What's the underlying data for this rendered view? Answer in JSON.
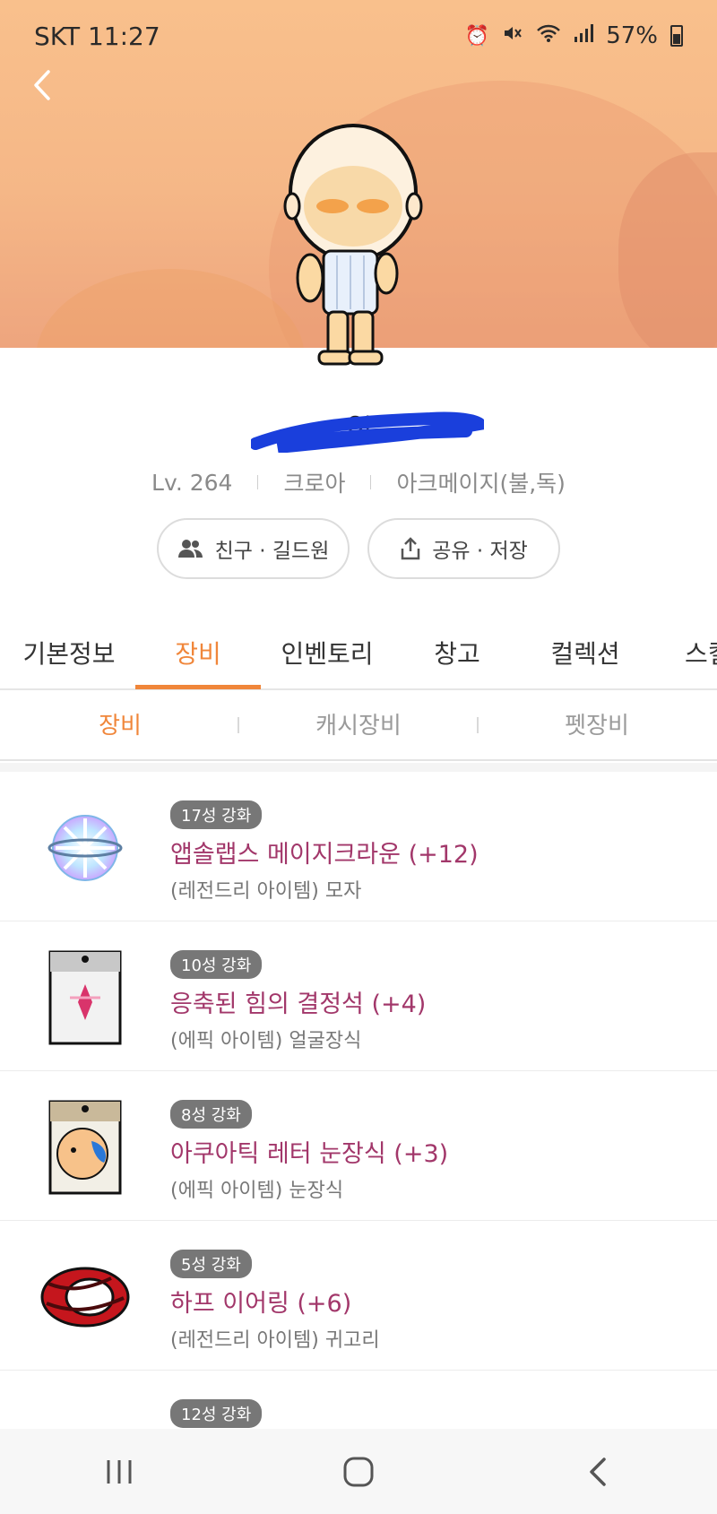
{
  "status_bar": {
    "carrier_time": "SKT 11:27",
    "battery": "57%",
    "icons": [
      "alarm-icon",
      "mute-icon",
      "wifi-icon",
      "signal-icon",
      "battery-icon"
    ]
  },
  "profile": {
    "name": "Ol",
    "level": "Lv. 264",
    "world": "크로아",
    "job": "아크메이지(불,독)",
    "buttons": {
      "friends": "친구 · 길드원",
      "share": "공유 · 저장"
    }
  },
  "tabs": [
    {
      "label": "기본정보"
    },
    {
      "label": "장비"
    },
    {
      "label": "인벤토리"
    },
    {
      "label": "창고"
    },
    {
      "label": "컬렉션"
    },
    {
      "label": "스킬"
    }
  ],
  "active_tab": "장비",
  "subtabs": [
    {
      "label": "장비"
    },
    {
      "label": "캐시장비"
    },
    {
      "label": "펫장비"
    }
  ],
  "items": [
    {
      "badge": "17성 강화",
      "name": "앱솔랩스 메이지크라운 (+12)",
      "sub": "(레전드리 아이템) 모자",
      "icon": "crown-icon"
    },
    {
      "badge": "10성 강화",
      "name": "응축된 힘의 결정석 (+4)",
      "sub": "(에픽 아이템) 얼굴장식",
      "icon": "crystal-card-icon"
    },
    {
      "badge": "8성 강화",
      "name": "아쿠아틱 레터 눈장식 (+3)",
      "sub": "(에픽 아이템) 눈장식",
      "icon": "eye-accessory-icon"
    },
    {
      "badge": "5성 강화",
      "name": "하프 이어링 (+6)",
      "sub": "(레전드리 아이템) 귀고리",
      "icon": "earring-icon"
    },
    {
      "badge": "12성 강화",
      "name": "",
      "sub": "",
      "icon": "item-icon"
    }
  ],
  "colors": {
    "accent": "#f0863a",
    "item_name": "#a2376a",
    "banner": "#f9c08c"
  }
}
